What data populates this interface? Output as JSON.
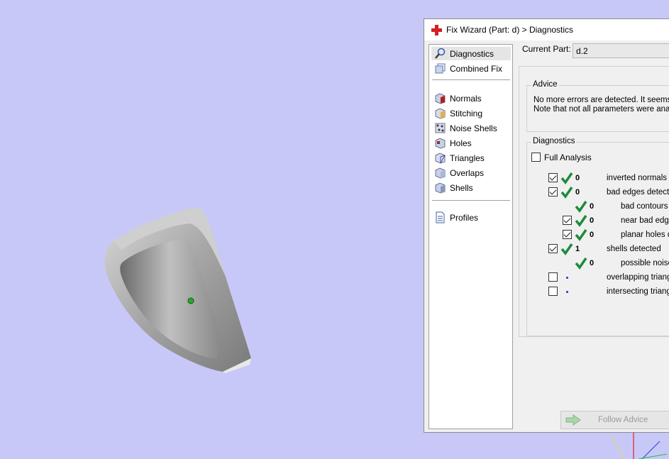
{
  "window": {
    "title": "Fix Wizard (Part: d) > Diagnostics"
  },
  "nav": {
    "items": [
      {
        "label": "Diagnostics",
        "icon": "magnifier-icon"
      },
      {
        "label": "Combined Fix",
        "icon": "combined-fix-icon"
      },
      {
        "label": "Normals",
        "icon": "normals-cube-icon"
      },
      {
        "label": "Stitching",
        "icon": "stitching-icon"
      },
      {
        "label": "Noise Shells",
        "icon": "noise-shells-icon"
      },
      {
        "label": "Holes",
        "icon": "holes-icon"
      },
      {
        "label": "Triangles",
        "icon": "triangles-icon"
      },
      {
        "label": "Overlaps",
        "icon": "overlaps-icon"
      },
      {
        "label": "Shells",
        "icon": "shells-icon"
      },
      {
        "label": "Profiles",
        "icon": "profiles-document-icon"
      }
    ]
  },
  "current_part": {
    "label": "Current Part:",
    "value": "d.2"
  },
  "advice": {
    "legend": "Advice",
    "line1": "No more errors are detected. It seems t",
    "line2": "Note that not all parameters were analy"
  },
  "diagnostics": {
    "legend": "Diagnostics",
    "full_analysis_label": "Full Analysis",
    "rows": [
      {
        "count": "0",
        "label": "inverted normals d"
      },
      {
        "count": "0",
        "label": "bad edges detecte"
      },
      {
        "count": "0",
        "label": "bad contours d"
      },
      {
        "count": "0",
        "label": "near bad edge"
      },
      {
        "count": "0",
        "label": "planar holes d"
      },
      {
        "count": "1",
        "label": "shells detected"
      },
      {
        "count": "0",
        "label": "possible noise"
      },
      {
        "count": "",
        "label": "overlapping triang"
      },
      {
        "count": "",
        "label": "intersecting triang"
      }
    ]
  },
  "follow_advice": {
    "label": "Follow Advice"
  },
  "colors": {
    "viewport_bg": "#c8c8f8",
    "check_green": "#1e8a3a",
    "title_icon_red": "#d42020"
  }
}
